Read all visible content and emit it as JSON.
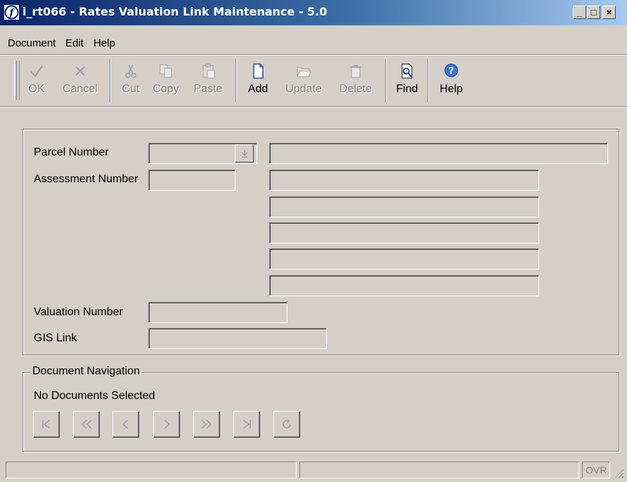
{
  "window": {
    "title": "i_rt066 - Rates Valuation Link Maintenance - 5.0",
    "controls": {
      "minimize": "_",
      "maximize": "□",
      "close": "×"
    }
  },
  "menu": [
    "Document",
    "Edit",
    "Help"
  ],
  "toolbar": {
    "ok": "OK",
    "cancel": "Cancel",
    "cut": "Cut",
    "copy": "Copy",
    "paste": "Paste",
    "add": "Add",
    "update": "Update",
    "delete": "Delete",
    "find": "Find",
    "help": "Help"
  },
  "form": {
    "parcel_number_label": "Parcel Number",
    "parcel_number_value": "",
    "parcel_description_value": "",
    "assessment_number_label": "Assessment Number",
    "assessment_number_value": "",
    "address_lines": [
      "",
      "",
      "",
      "",
      ""
    ],
    "valuation_number_label": "Valuation Number",
    "valuation_number_value": "",
    "gis_link_label": "GIS Link",
    "gis_link_value": ""
  },
  "navigation": {
    "legend": "Document Navigation",
    "status": "No Documents Selected"
  },
  "statusbar": {
    "panel1": "",
    "panel2": "",
    "mode": "OVR"
  },
  "colors": {
    "face": "#d4d0c8",
    "title_start": "#0a246a",
    "title_end": "#a6caf0",
    "disabled_text": "#808080"
  }
}
